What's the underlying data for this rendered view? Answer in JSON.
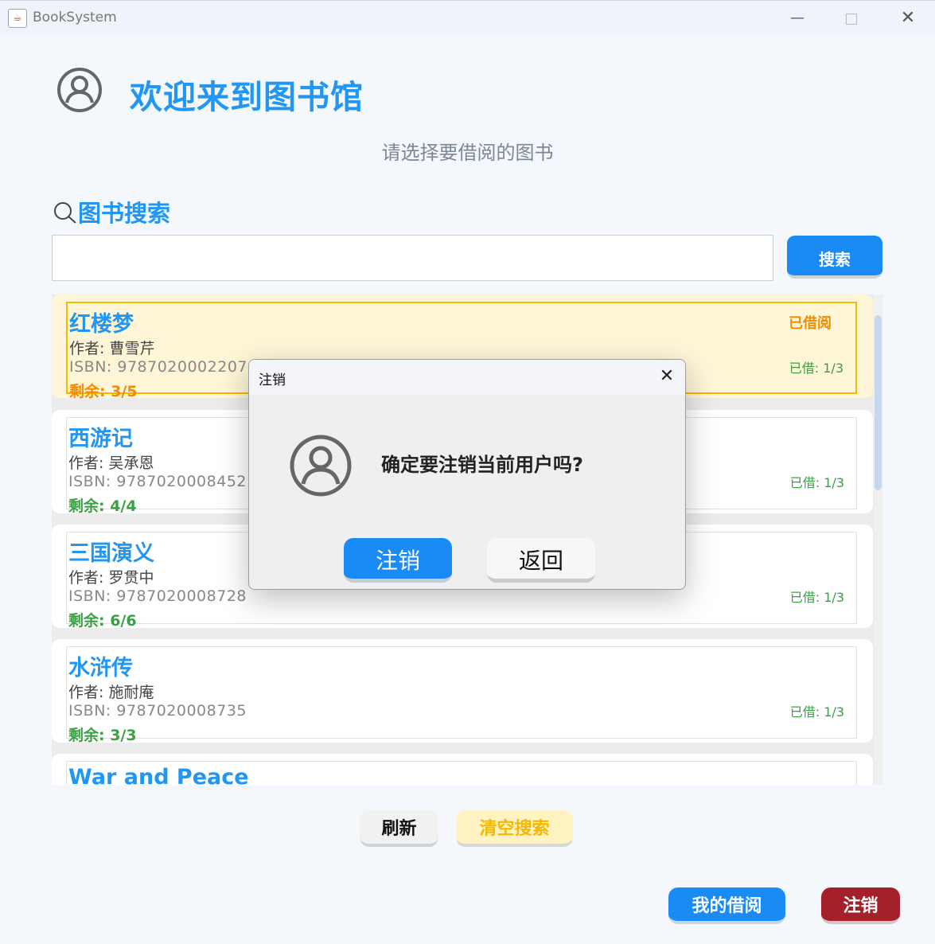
{
  "window": {
    "title": "BookSystem",
    "app_icon_glyph": "☕",
    "minimize_glyph": "—",
    "close_glyph": "✕"
  },
  "header": {
    "title": "欢迎来到图书馆",
    "subtitle": "请选择要借阅的图书"
  },
  "search": {
    "heading": "图书搜索",
    "input_value": "",
    "button_label": "搜索"
  },
  "books": [
    {
      "name": "红楼梦",
      "author": "作者: 曹雪芹",
      "isbn": "ISBN: 9787020002207",
      "remaining": "剩余: 3/5",
      "status": "已借阅",
      "borrow_count": "已借: 1/3"
    },
    {
      "name": "西游记",
      "author": "作者: 吴承恩",
      "isbn": "ISBN: 9787020008452",
      "remaining": "剩余: 4/4",
      "status": "",
      "borrow_count": "已借: 1/3"
    },
    {
      "name": "三国演义",
      "author": "作者: 罗贯中",
      "isbn": "ISBN: 9787020008728",
      "remaining": "剩余: 6/6",
      "status": "",
      "borrow_count": "已借: 1/3"
    },
    {
      "name": "水浒传",
      "author": "作者: 施耐庵",
      "isbn": "ISBN: 9787020008735",
      "remaining": "剩余: 3/3",
      "status": "",
      "borrow_count": "已借: 1/3"
    },
    {
      "name": "War and Peace",
      "author": "",
      "isbn": "",
      "remaining": "",
      "status": "",
      "borrow_count": ""
    }
  ],
  "actions": {
    "refresh_label": "刷新",
    "clear_label": "清空搜索",
    "my_borrow_label": "我的借阅",
    "logout_label": "注销"
  },
  "dialog": {
    "title": "注销",
    "close_glyph": "✕",
    "message": "确定要注销当前用户吗?",
    "confirm_label": "注销",
    "back_label": "返回"
  },
  "colors": {
    "accent": "#2196f3",
    "primary_button": "#1a8af5",
    "danger_button": "#a4202a",
    "warning": "#f08c00",
    "success": "#3aa043",
    "highlight_card": "#fff6d8"
  }
}
